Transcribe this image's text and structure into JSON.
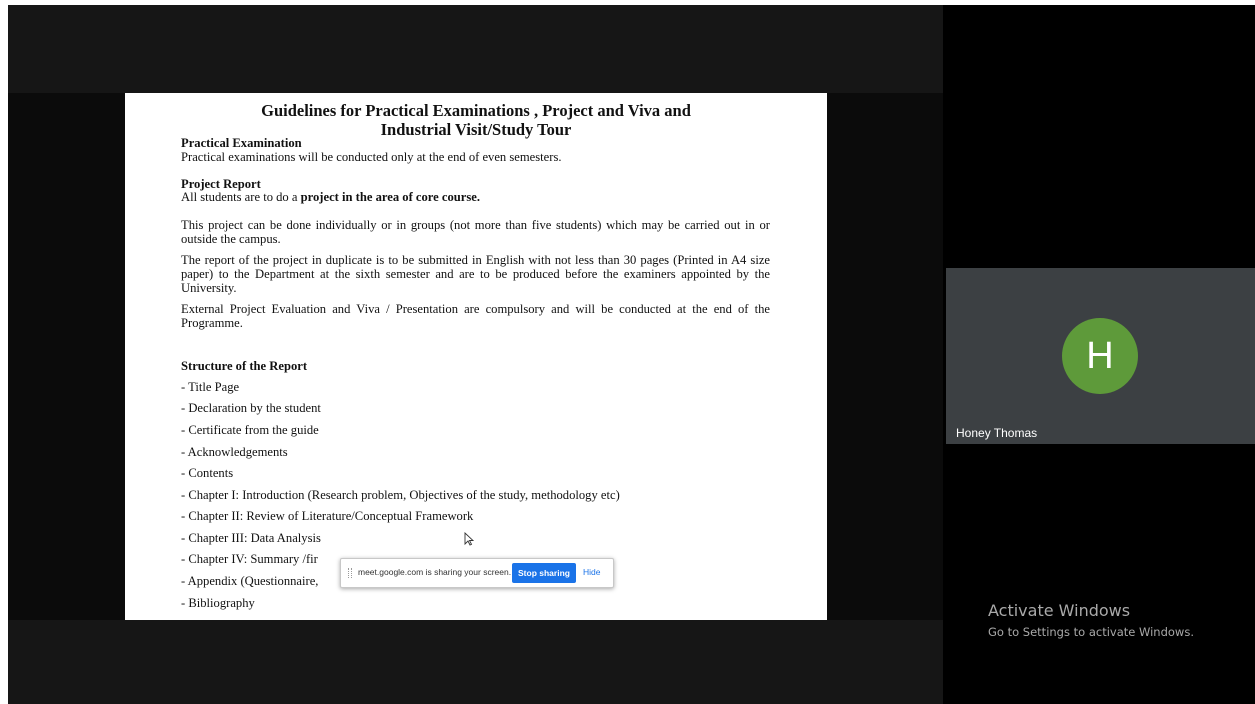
{
  "slide": {
    "title_line1": "Guidelines for Practical Examinations , Project and Viva and",
    "title_line2": "Industrial Visit/Study Tour",
    "practical_heading": "Practical Examination",
    "practical_text": "Practical examinations will be conducted only at the end of even semesters.",
    "project_heading": "Project Report",
    "project_line_prefix": "All students are to do a ",
    "project_line_bold": "project in the area of core course.",
    "para_groups": "This project can be done individually or in groups (not more than five students) which may be carried out in or outside the campus.",
    "para_report": "The report of the project in duplicate is to be submitted in English with not less than 30 pages (Printed in A4 size paper) to the Department at the sixth semester and are to be produced before the examiners appointed by the University.",
    "para_external": "External Project Evaluation and Viva / Presentation are compulsory and will be conducted at the end of the Programme.",
    "structure_heading": "Structure of the Report",
    "structure_items": [
      "- Title Page",
      "- Declaration by the student",
      "- Certificate from the guide",
      "- Acknowledgements",
      "- Contents",
      "- Chapter I: Introduction (Research problem, Objectives of the study, methodology etc)",
      "- Chapter II: Review of Literature/Conceptual Framework",
      "- Chapter III: Data Analysis",
      "- Chapter IV: Summary /fir",
      "- Appendix (Questionnaire,",
      "- Bibliography"
    ]
  },
  "share_bar": {
    "message": "meet.google.com is sharing your screen.",
    "stop_label": "Stop sharing",
    "hide_label": "Hide"
  },
  "participant": {
    "initial": "H",
    "name": "Honey Thomas",
    "avatar_color": "#5e9a3a"
  },
  "watermark": {
    "line1": "Activate Windows",
    "line2": "Go to Settings to activate Windows."
  },
  "colors": {
    "accent": "#1a73e8",
    "tile_bg": "#3c4043"
  }
}
